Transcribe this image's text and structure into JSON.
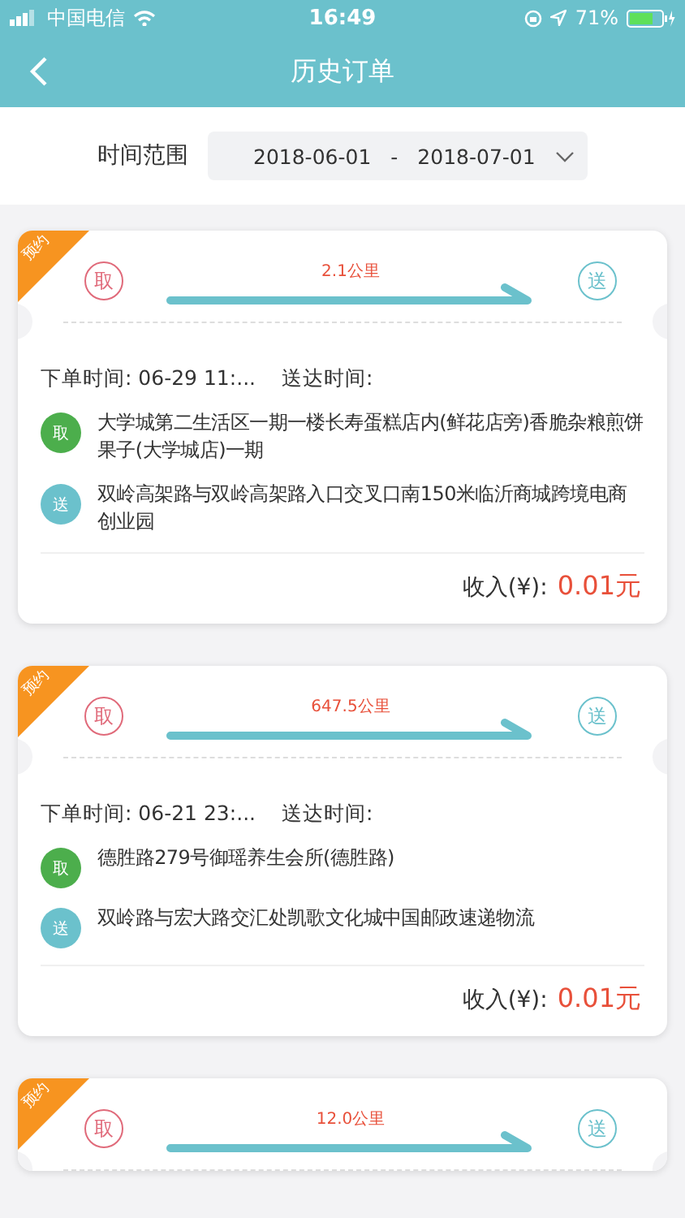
{
  "status_bar": {
    "carrier": "中国电信",
    "time": "16:49",
    "battery": "71%"
  },
  "nav": {
    "title": "历史订单"
  },
  "filter": {
    "label": "时间范围",
    "start": "2018-06-01",
    "separator": "-",
    "end": "2018-07-01"
  },
  "orders": [
    {
      "badge": "预约",
      "pickup_mark": "取",
      "delivery_mark": "送",
      "distance": "2.1公里",
      "order_time_label": "下单时间:",
      "order_time": "06-29 11:...",
      "delivery_time_label": "送达时间:",
      "stops": [
        {
          "marker": "取",
          "color": "#4cae4c",
          "address": "大学城第二生活区一期一楼长寿蛋糕店内(鲜花店旁)香脆杂粮煎饼果子(大学城店)一期"
        },
        {
          "marker": "送",
          "color": "#6bc1cc",
          "address": "双岭高架路与双岭高架路入口交叉口南150米临沂商城跨境电商创业园"
        }
      ],
      "income_label": "收入(¥):",
      "income": "0.01元"
    },
    {
      "badge": "预约",
      "pickup_mark": "取",
      "delivery_mark": "送",
      "distance": "647.5公里",
      "order_time_label": "下单时间:",
      "order_time": "06-21 23:...",
      "delivery_time_label": "送达时间:",
      "stops": [
        {
          "marker": "取",
          "color": "#4cae4c",
          "address": "德胜路279号御瑶养生会所(德胜路)"
        },
        {
          "marker": "送",
          "color": "#6bc1cc",
          "address": "双岭路与宏大路交汇处凯歌文化城中国邮政速递物流"
        }
      ],
      "income_label": "收入(¥):",
      "income": "0.01元"
    },
    {
      "badge": "预约",
      "pickup_mark": "取",
      "delivery_mark": "送",
      "distance": "12.0公里"
    }
  ]
}
